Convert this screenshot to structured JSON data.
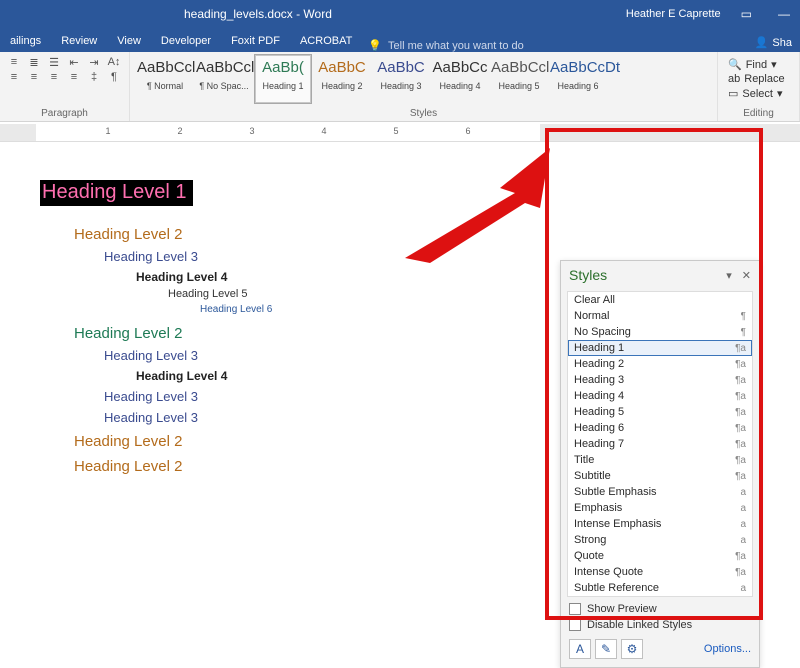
{
  "title": "heading_levels.docx - Word",
  "user": "Heather E Caprette",
  "tabs": [
    "ailings",
    "Review",
    "View",
    "Developer",
    "Foxit PDF",
    "ACROBAT"
  ],
  "tellme": "Tell me what you want to do",
  "share": "Sha",
  "ribbon": {
    "paragraph_label": "Paragraph",
    "styles_label": "Styles",
    "editing_label": "Editing",
    "styles": [
      {
        "sample": "AaBbCcl",
        "name": "¶ Normal",
        "color": "#333"
      },
      {
        "sample": "AaBbCcl",
        "name": "¶ No Spac...",
        "color": "#333"
      },
      {
        "sample": "AaBb(",
        "name": "Heading 1",
        "color": "#2e7a55"
      },
      {
        "sample": "AaBbC",
        "name": "Heading 2",
        "color": "#b36b1b"
      },
      {
        "sample": "AaBbC",
        "name": "Heading 3",
        "color": "#3a4b8f"
      },
      {
        "sample": "AaBbCc",
        "name": "Heading 4",
        "color": "#333"
      },
      {
        "sample": "AaBbCcl",
        "name": "Heading 5",
        "color": "#555"
      },
      {
        "sample": "AaBbCcDt",
        "name": "Heading 6",
        "color": "#2b579a"
      }
    ],
    "editing": {
      "find": "Find",
      "replace": "Replace",
      "select": "Select"
    }
  },
  "ruler_numbers": [
    "1",
    "2",
    "3",
    "4",
    "5",
    "6"
  ],
  "doc": {
    "h1": "Heading Level 1",
    "h2a": "Heading Level 2",
    "h3a": "Heading Level 3",
    "h4a": "Heading Level 4",
    "h5": "Heading Level 5",
    "h6": "Heading Level 6",
    "h2b": "Heading Level 2",
    "h3b": "Heading Level 3",
    "h4b": "Heading Level 4",
    "h3c": "Heading Level 3",
    "h3d": "Heading Level 3",
    "h2c": "Heading Level 2",
    "h2d": "Heading Level 2"
  },
  "styles_pane": {
    "title": "Styles",
    "items": [
      {
        "label": "Clear All",
        "ind": ""
      },
      {
        "label": "Normal",
        "ind": "¶"
      },
      {
        "label": "No Spacing",
        "ind": "¶"
      },
      {
        "label": "Heading 1",
        "ind": "¶a",
        "selected": true
      },
      {
        "label": "Heading 2",
        "ind": "¶a"
      },
      {
        "label": "Heading 3",
        "ind": "¶a"
      },
      {
        "label": "Heading 4",
        "ind": "¶a"
      },
      {
        "label": "Heading 5",
        "ind": "¶a"
      },
      {
        "label": "Heading 6",
        "ind": "¶a"
      },
      {
        "label": "Heading 7",
        "ind": "¶a"
      },
      {
        "label": "Title",
        "ind": "¶a"
      },
      {
        "label": "Subtitle",
        "ind": "¶a"
      },
      {
        "label": "Subtle Emphasis",
        "ind": "a"
      },
      {
        "label": "Emphasis",
        "ind": "a"
      },
      {
        "label": "Intense Emphasis",
        "ind": "a"
      },
      {
        "label": "Strong",
        "ind": "a"
      },
      {
        "label": "Quote",
        "ind": "¶a"
      },
      {
        "label": "Intense Quote",
        "ind": "¶a"
      },
      {
        "label": "Subtle Reference",
        "ind": "a"
      }
    ],
    "show_preview": "Show Preview",
    "disable_linked": "Disable Linked Styles",
    "options": "Options..."
  }
}
